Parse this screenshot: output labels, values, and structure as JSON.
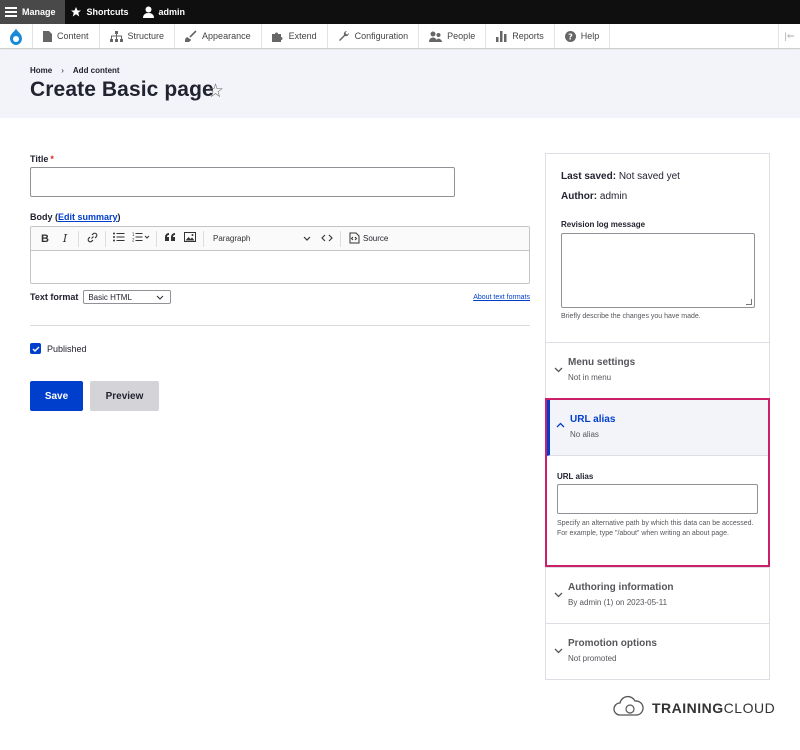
{
  "toolbar": {
    "manage": "Manage",
    "shortcuts": "Shortcuts",
    "user": "admin"
  },
  "tray": {
    "items": [
      "Content",
      "Structure",
      "Appearance",
      "Extend",
      "Configuration",
      "People",
      "Reports",
      "Help"
    ],
    "collapse": "|⇐"
  },
  "header": {
    "breadcrumb": [
      "Home",
      "Add content"
    ],
    "breadcrumb_sep": "›",
    "title": "Create Basic page",
    "star": "☆"
  },
  "form": {
    "title_label": "Title",
    "required_mark": "*",
    "body_label": "Body",
    "edit_summary": "Edit summary",
    "editor": {
      "bold": "B",
      "italic": "I",
      "paragraph": "Paragraph",
      "source": "Source"
    },
    "text_format_label": "Text format",
    "text_format_value": "Basic HTML",
    "about_formats": "About text formats",
    "published": "Published",
    "save": "Save",
    "preview": "Preview"
  },
  "sidebar": {
    "last_saved_label": "Last saved:",
    "last_saved_value": "Not saved yet",
    "author_label": "Author:",
    "author_value": "admin",
    "revision_label": "Revision log message",
    "revision_desc": "Briefly describe the changes you have made.",
    "menu": {
      "title": "Menu settings",
      "summary": "Not in menu"
    },
    "url": {
      "title": "URL alias",
      "summary": "No alias",
      "field_label": "URL alias",
      "desc": "Specify an alternative path by which this data can be accessed. For example, type \"/about\" when writing an about page."
    },
    "authoring": {
      "title": "Authoring information",
      "summary": "By admin (1) on 2023-05-11"
    },
    "promotion": {
      "title": "Promotion options",
      "summary": "Not promoted"
    }
  },
  "branding": {
    "name_bold": "TRAINING",
    "name_rest": "CLOUD"
  },
  "colors": {
    "primary": "#003ecc",
    "highlight": "#cc1f6a",
    "toolbar": "#0f0f0f"
  }
}
